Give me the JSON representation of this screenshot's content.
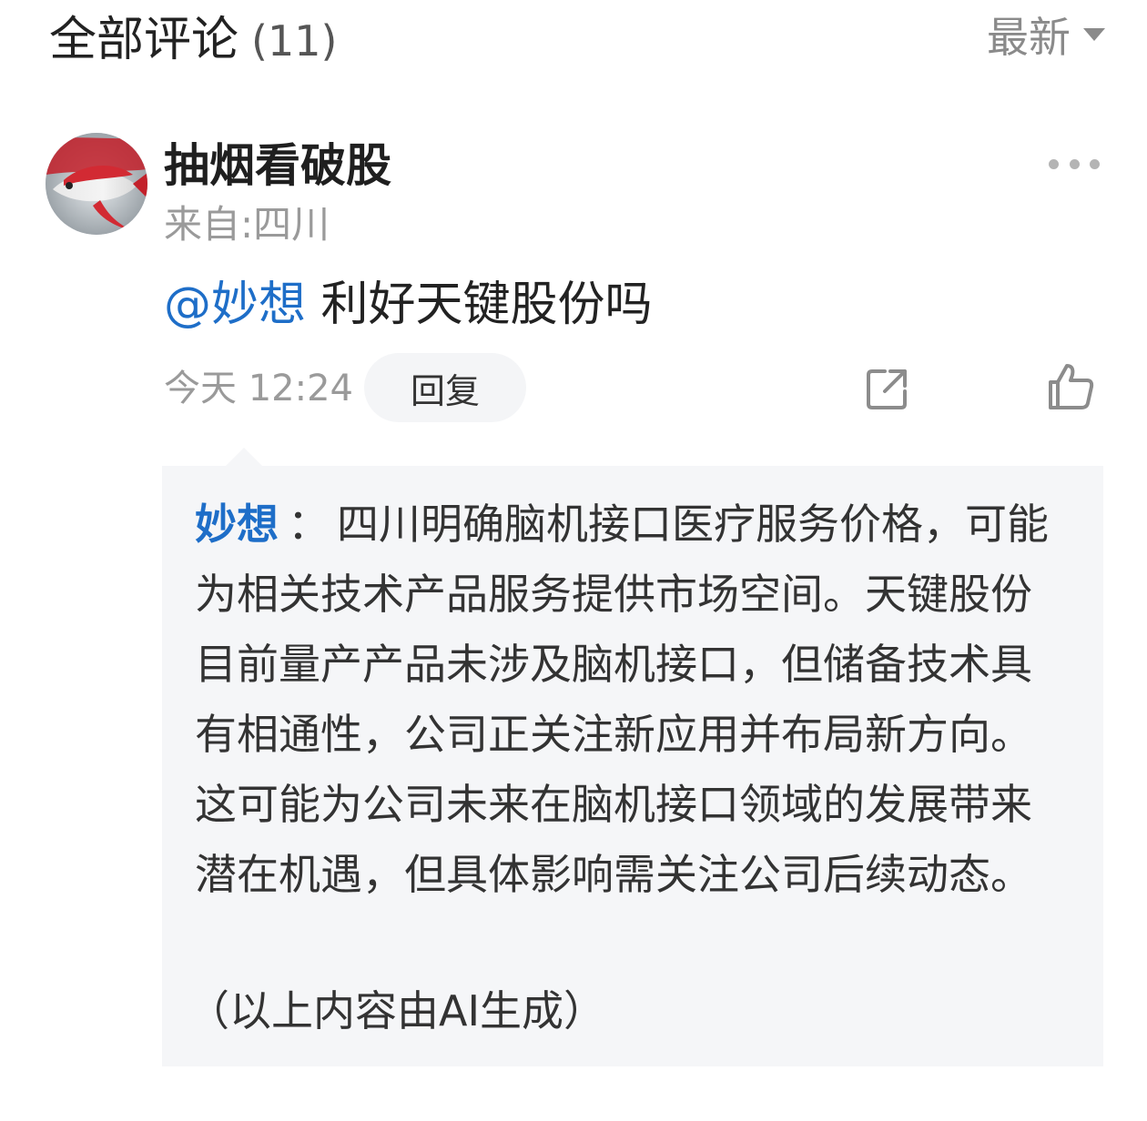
{
  "header": {
    "title": "全部评论",
    "count": "(11)",
    "sort_label": "最新",
    "sort_icon": "caret-down-icon"
  },
  "comment": {
    "username": "抽烟看破股",
    "location": "来自:四川",
    "mention": "@妙想",
    "text": "利好天键股份吗",
    "timestamp": "今天 12:24",
    "reply_label": "回复",
    "more_icon": "more-horizontal-icon",
    "share_icon": "share-icon",
    "like_icon": "thumbs-up-icon",
    "avatar_icon": "fish-avatar"
  },
  "ai_reply": {
    "author": "妙想",
    "separator": "：",
    "body": "四川明确脑机接口医疗服务价格，可能为相关技术产品服务提供市场空间。天键股份目前量产产品未涉及脑机接口，但储备技术具有相通性，公司正关注新应用并布局新方向。这可能为公司未来在脑机接口领域的发展带来潜在机遇，但具体影响需关注公司后续动态。",
    "note": "（以上内容由AI生成）"
  },
  "colors": {
    "link_blue": "#1e6ec8",
    "muted_gray": "#9a9a9a",
    "panel_bg": "#f5f6f8"
  }
}
